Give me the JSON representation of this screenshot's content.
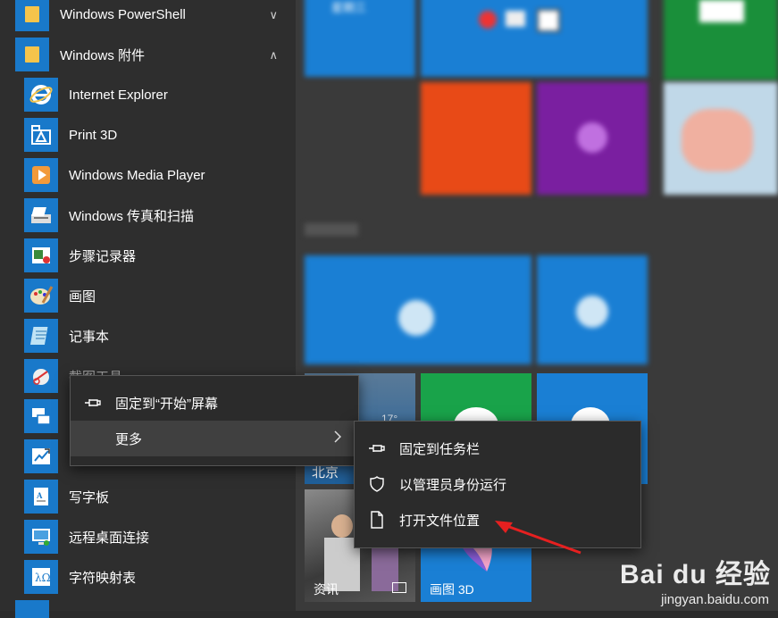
{
  "start_menu": {
    "folders": [
      {
        "label": "Windows PowerShell",
        "chevron": "∨"
      },
      {
        "label": "Windows 附件",
        "chevron": "∧"
      }
    ],
    "apps": [
      {
        "label": "Internet Explorer",
        "icon": "ie-icon"
      },
      {
        "label": "Print 3D",
        "icon": "print3d-icon"
      },
      {
        "label": "Windows Media Player",
        "icon": "media-player-icon"
      },
      {
        "label": "Windows 传真和扫描",
        "icon": "fax-scan-icon"
      },
      {
        "label": "步骤记录器",
        "icon": "steps-recorder-icon"
      },
      {
        "label": "画图",
        "icon": "paint-icon"
      },
      {
        "label": "记事本",
        "icon": "notepad-icon"
      },
      {
        "label": "截图工具",
        "icon": "snipping-tool-icon"
      },
      {
        "label": "",
        "icon": "remote-desktop-icon"
      },
      {
        "label": "",
        "icon": "math-input-icon"
      },
      {
        "label": "写字板",
        "icon": "wordpad-icon"
      },
      {
        "label": "远程桌面连接",
        "icon": "remote-connection-icon"
      },
      {
        "label": "字符映射表",
        "icon": "charmap-icon"
      }
    ]
  },
  "context_menu": {
    "pin_start": "固定到“开始”屏幕",
    "more": "更多"
  },
  "submenu": {
    "pin_taskbar": "固定到任务栏",
    "run_admin": "以管理员身份运行",
    "open_location": "打开文件位置"
  },
  "tiles": {
    "weather_city": "北京",
    "weather_temp": "17°",
    "news": "资讯",
    "paint3d": "画图 3D",
    "top_label": "星期三"
  },
  "watermark": {
    "brand": "Bai du 经验",
    "url": "jingyan.baidu.com"
  }
}
